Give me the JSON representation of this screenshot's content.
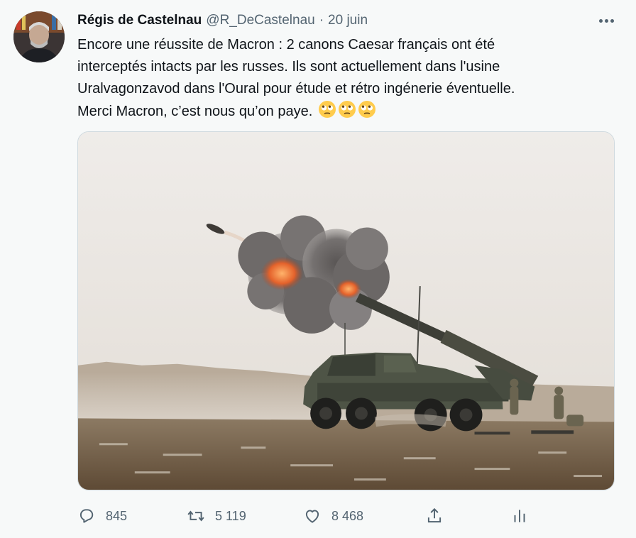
{
  "tweet": {
    "author_name": "Régis de Castelnau",
    "handle": "@R_DeCastelnau",
    "separator": "·",
    "date": "20 juin",
    "text_lines": [
      "Encore une réussite de Macron : 2 canons Caesar français ont été",
      "interceptés intacts par les russes. Ils sont actuellement dans l'usine",
      "Uralvagonzavod dans l'Oural pour étude et rétro ingénerie éventuelle.",
      "Merci Macron, c’est nous qu’on paye."
    ],
    "emojis": [
      "face-with-rolling-eyes",
      "face-with-rolling-eyes",
      "face-with-rolling-eyes"
    ]
  },
  "media": {
    "description_icon": "caesar-howitzer-firing-photo"
  },
  "actions": {
    "reply": {
      "icon": "reply-icon",
      "count": "845"
    },
    "retweet": {
      "icon": "retweet-icon",
      "count": "5 119"
    },
    "like": {
      "icon": "heart-icon",
      "count": "8 468"
    },
    "share": {
      "icon": "share-icon"
    },
    "analytics": {
      "icon": "analytics-icon"
    }
  },
  "colors": {
    "background": "#f7f9f9",
    "text": "#0f1419",
    "secondary": "#536471"
  }
}
